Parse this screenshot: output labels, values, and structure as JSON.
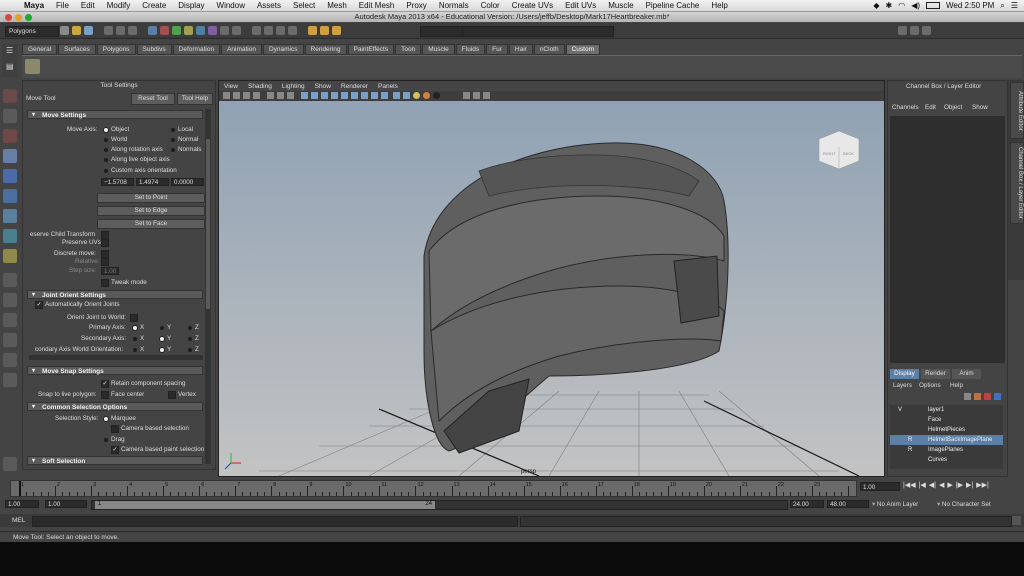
{
  "macmenu": {
    "items": [
      "Maya",
      "File",
      "Edit",
      "Modify",
      "Create",
      "Display",
      "Window",
      "Assets",
      "Select",
      "Mesh",
      "Edit Mesh",
      "Proxy",
      "Normals",
      "Color",
      "Create UVs",
      "Edit UVs",
      "Muscle",
      "Pipeline Cache",
      "Help"
    ],
    "clock": "Wed 2:50 PM"
  },
  "window": {
    "title": "Autodesk Maya 2013 x64 - Educational Version: /Users/jeffb/Desktop/Mark17Heartbreaker.mb*"
  },
  "statusline": {
    "menuset": "Polygons"
  },
  "shelf": {
    "tabs": [
      "General",
      "Surfaces",
      "Polygons",
      "Subdivs",
      "Deformation",
      "Animation",
      "Dynamics",
      "Rendering",
      "PaintEffects",
      "Toon",
      "Muscle",
      "Fluids",
      "Fur",
      "Hair",
      "nCloth",
      "Custom"
    ],
    "active": "Custom"
  },
  "toolsettings": {
    "header": "Tool Settings",
    "tool_name": "Move Tool",
    "reset_btn": "Reset Tool",
    "help_btn": "Tool Help",
    "move_settings": {
      "title": "Move Settings",
      "move_axis_label": "Move Axis:",
      "opt_object": "Object",
      "opt_local": "Local",
      "opt_world": "World",
      "opt_normal": "Normal",
      "opt_rotation": "Along rotation axis",
      "opt_normals": "Normals",
      "opt_live": "Along live object axis",
      "opt_custom": "Custom axis orientation",
      "v1": "−1.5708",
      "v2": "1.4974",
      "v3": "0.0000",
      "set_point": "Set to Point",
      "set_edge": "Set to Edge",
      "set_face": "Set to Face",
      "preserve_child": "eserve Child Transform",
      "preserve_uvs": "Preserve UVs",
      "discrete": "Discrete move:",
      "relative": "Relative:",
      "step_size": "Step size:",
      "step_value": "1.00",
      "tweak": "Tweak mode"
    },
    "joint_orient": {
      "title": "Joint Orient Settings",
      "auto": "Automatically Orient Joints",
      "orient_world": "Orient Joint to World:",
      "primary": "Primary Axis:",
      "secondary": "Secondary Axis:",
      "secondary_world": "condary Axis World Orientation:",
      "x": "X",
      "y": "Y",
      "z": "Z"
    },
    "move_snap": {
      "title": "Move Snap Settings",
      "retain": "Retain component spacing",
      "snap_live": "Snap to live polygon:",
      "face_center": "Face center",
      "vertex": "Vertex"
    },
    "common_sel": {
      "title": "Common Selection Options",
      "style": "Selection Style:",
      "marquee": "Marquee",
      "camera_sel": "Camera based selection",
      "drag": "Drag",
      "camera_paint": "Camera based paint selection"
    },
    "soft_sel": {
      "title": "Soft Selection"
    }
  },
  "viewport": {
    "menu": [
      "View",
      "Shading",
      "Lighting",
      "Show",
      "Renderer",
      "Panels"
    ],
    "camera": "persp",
    "viewcube": {
      "right": "RIGHT",
      "back": "BACK"
    }
  },
  "channelbox": {
    "title": "Channel Box / Layer Editor",
    "menu": [
      "Channels",
      "Edit",
      "Object",
      "Show"
    ],
    "layer_tabs": [
      "Display",
      "Render",
      "Anim"
    ],
    "layer_menu": [
      "Layers",
      "Options",
      "Help"
    ],
    "layers": [
      {
        "flag": "V",
        "name": "layer1"
      },
      {
        "flag": "",
        "name": "Face"
      },
      {
        "flag": "",
        "name": "HelmetPieces"
      },
      {
        "flag": "R",
        "name": "HelmetBackImagePlane"
      },
      {
        "flag": "R",
        "name": "ImagePlanes"
      },
      {
        "flag": "",
        "name": "Curves"
      }
    ],
    "side_tabs": [
      "Attribute Editor",
      "Channel Box / Layer Editor"
    ]
  },
  "timeline": {
    "ticks": [
      "1",
      "2",
      "3",
      "4",
      "5",
      "6",
      "7",
      "8",
      "9",
      "10",
      "11",
      "12",
      "13",
      "14",
      "15",
      "16",
      "17",
      "18",
      "19",
      "20",
      "21",
      "22",
      "23",
      "24"
    ],
    "current": "1.00",
    "range_start": "1.00",
    "range_start2": "1.00",
    "range_inner_start": "1",
    "range_inner_end": "24",
    "range_end": "24.00",
    "range_end2": "48.00",
    "anim_layer": "No Anim Layer",
    "char_set": "No Character Set"
  },
  "mel": {
    "label": "MEL"
  },
  "help": {
    "text": "Move Tool: Select an object to move."
  },
  "colors": {
    "accent": "#5b7fa6",
    "panel": "#444444",
    "viewport_top": "#8da0b3",
    "viewport_bottom": "#c3c3c3"
  }
}
